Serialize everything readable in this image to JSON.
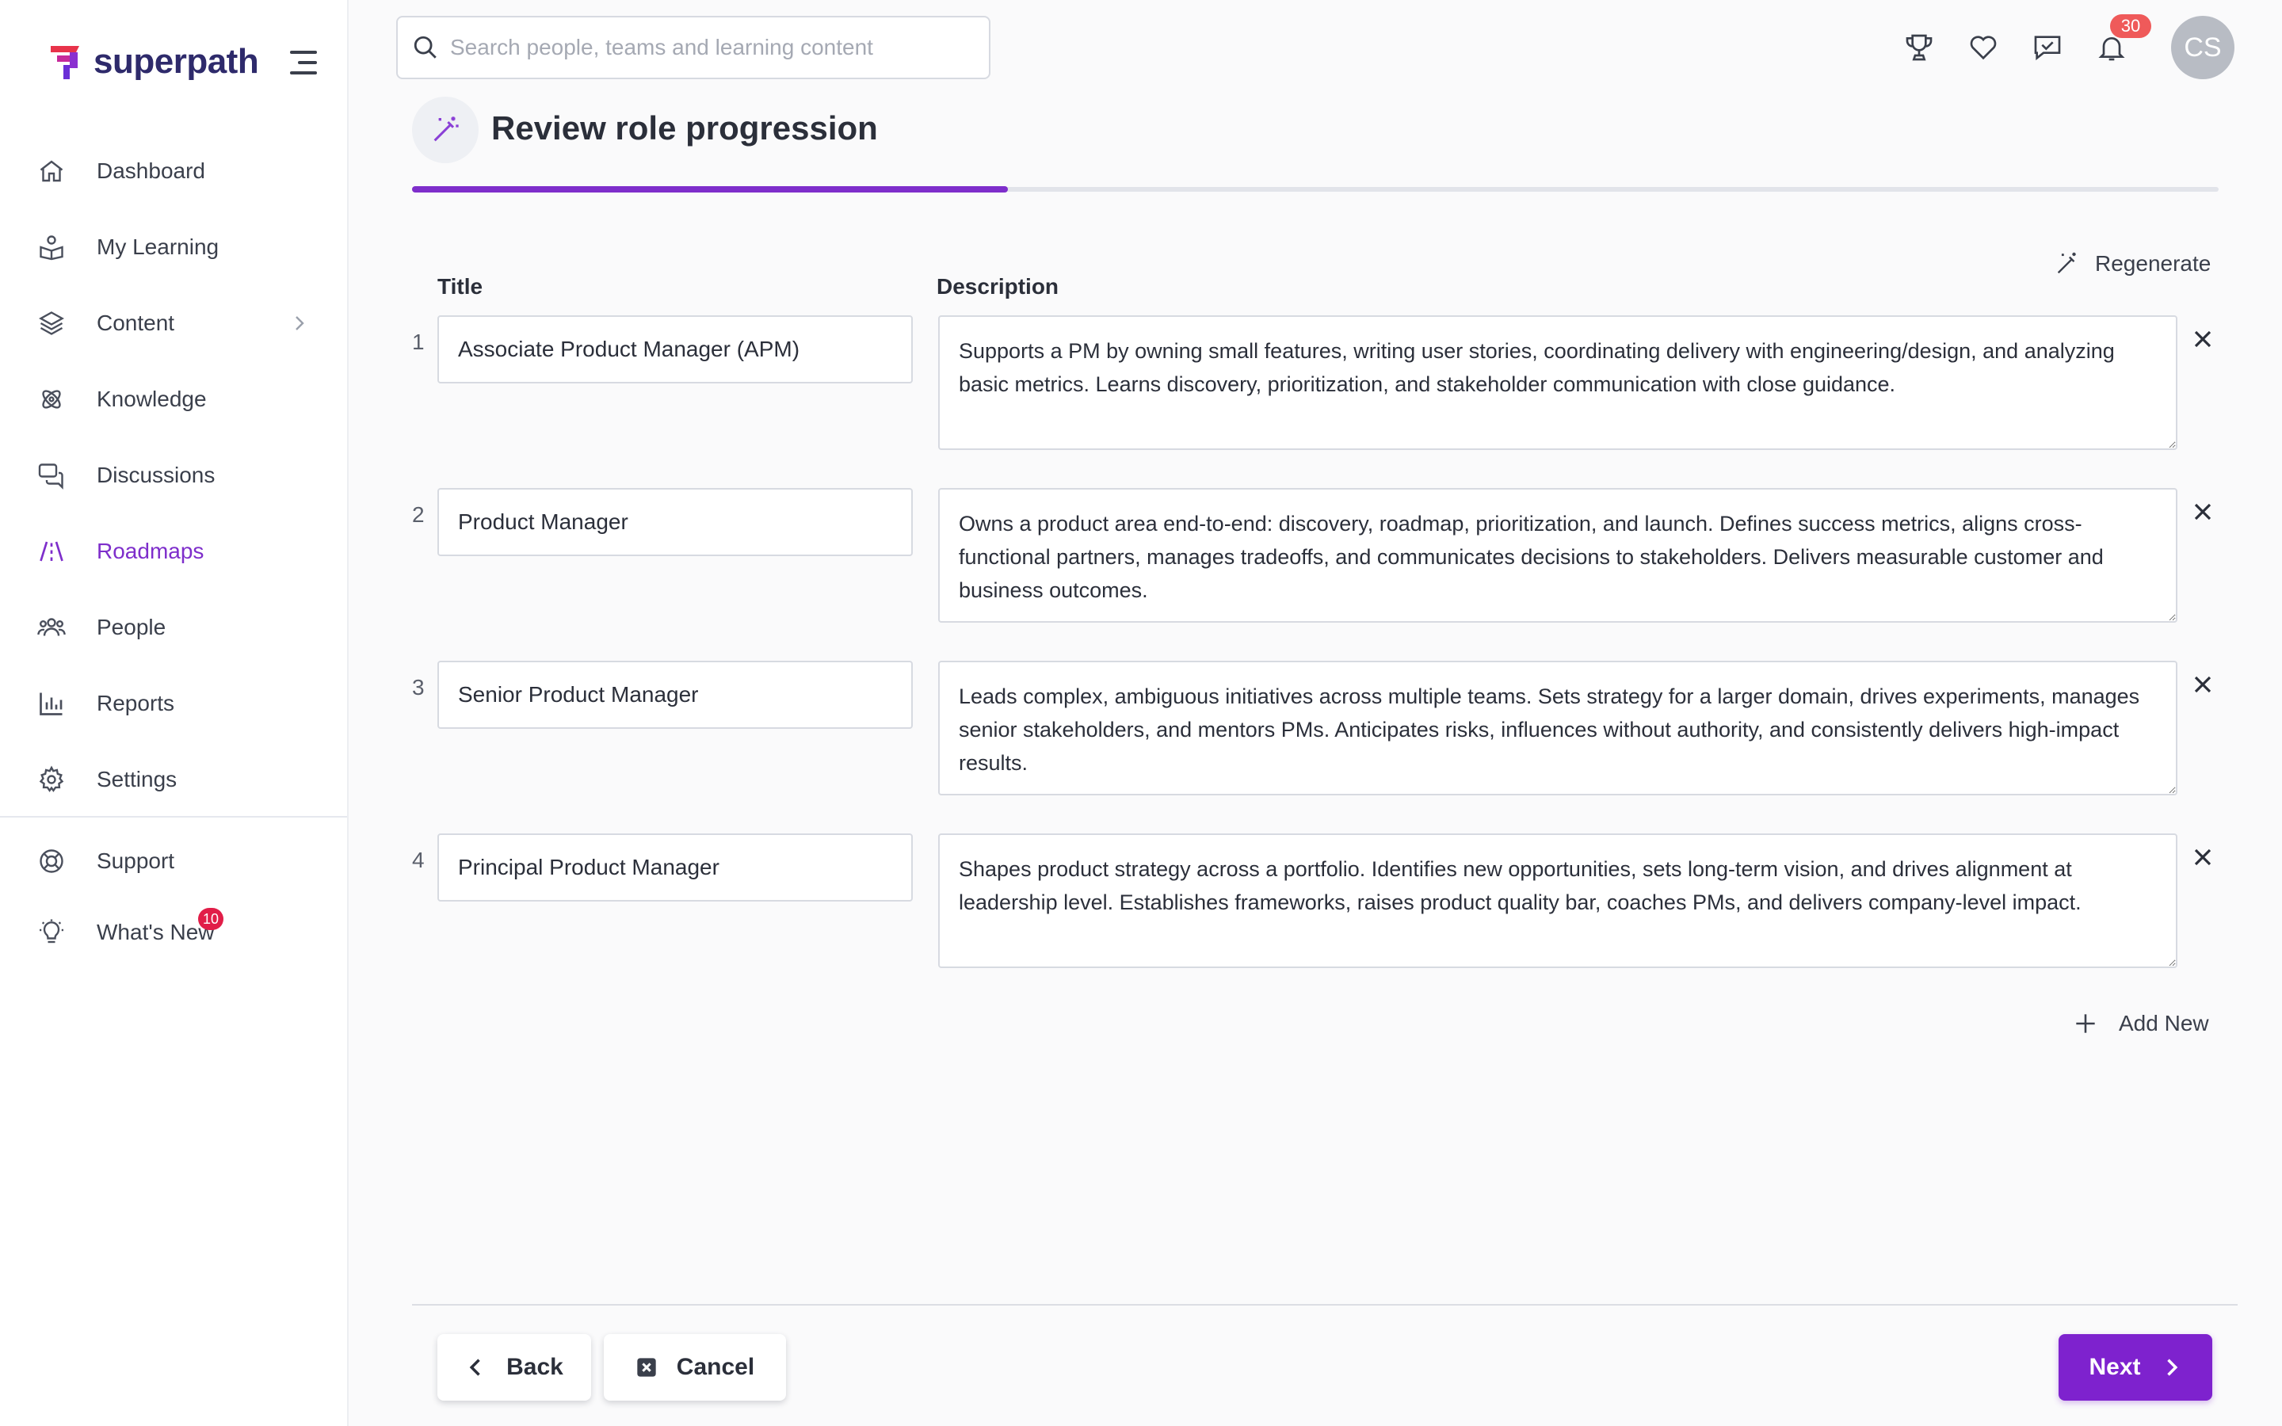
{
  "app": {
    "name": "superpath"
  },
  "sidebar": {
    "items": [
      {
        "label": "Dashboard",
        "icon": "home-icon"
      },
      {
        "label": "My Learning",
        "icon": "book-user-icon"
      },
      {
        "label": "Content",
        "icon": "layers-icon"
      },
      {
        "label": "Knowledge",
        "icon": "atom-icon"
      },
      {
        "label": "Discussions",
        "icon": "chat-bubbles-icon"
      },
      {
        "label": "Roadmaps",
        "icon": "road-icon",
        "active": true
      },
      {
        "label": "People",
        "icon": "users-icon"
      },
      {
        "label": "Reports",
        "icon": "bar-chart-icon"
      },
      {
        "label": "Settings",
        "icon": "gear-icon"
      }
    ],
    "secondary": [
      {
        "label": "Support",
        "icon": "lifebuoy-icon"
      },
      {
        "label": "What's New",
        "icon": "lightbulb-icon",
        "badge": "10"
      }
    ]
  },
  "topbar": {
    "search_placeholder": "Search people, teams and learning content",
    "notifications_count": "30",
    "avatar_initials": "CS"
  },
  "page": {
    "title": "Review role progression",
    "progress": 0.33
  },
  "form": {
    "regenerate_label": "Regenerate",
    "title_header": "Title",
    "description_header": "Description",
    "add_new_label": "Add New",
    "roles": [
      {
        "number": "1",
        "title": "Associate Product Manager (APM)",
        "description": "Supports a PM by owning small features, writing user stories, coordinating delivery with engineering/design, and analyzing basic metrics. Learns discovery, prioritization, and stakeholder communication with close guidance."
      },
      {
        "number": "2",
        "title": "Product Manager",
        "description": "Owns a product area end-to-end: discovery, roadmap, prioritization, and launch. Defines success metrics, aligns cross-functional partners, manages tradeoffs, and communicates decisions to stakeholders. Delivers measurable customer and business outcomes."
      },
      {
        "number": "3",
        "title": "Senior Product Manager",
        "description": "Leads complex, ambiguous initiatives across multiple teams. Sets strategy for a larger domain, drives experiments, manages senior stakeholders, and mentors PMs. Anticipates risks, influences without authority, and consistently delivers high-impact results."
      },
      {
        "number": "4",
        "title": "Principal Product Manager",
        "description": "Shapes product strategy across a portfolio. Identifies new opportunities, sets long-term vision, and drives alignment at leadership level. Establishes frameworks, raises product quality bar, coaches PMs, and delivers company-level impact."
      }
    ]
  },
  "footer": {
    "back_label": "Back",
    "cancel_label": "Cancel",
    "next_label": "Next"
  },
  "colors": {
    "accent": "#7e22ce",
    "badge": "#ef5a5a",
    "logo_red": "#e8334a",
    "logo_purple": "#6a2fd6"
  }
}
